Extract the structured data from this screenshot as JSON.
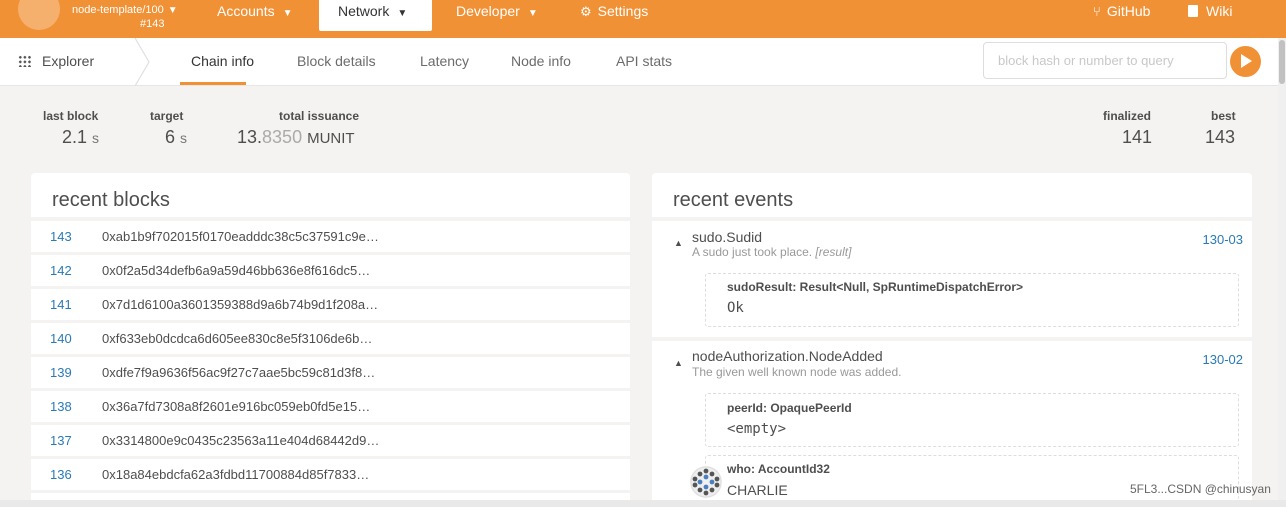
{
  "topbar": {
    "chain_name": "node-template/100",
    "chain_number": "#143",
    "accounts": "Accounts",
    "network": "Network",
    "developer": "Developer",
    "settings": "Settings",
    "github": "GitHub",
    "wiki": "Wiki"
  },
  "subbar": {
    "explorer": "Explorer",
    "tabs": [
      "Chain info",
      "Block details",
      "Latency",
      "Node info",
      "API stats"
    ],
    "search_placeholder": "block hash or number to query"
  },
  "summary": {
    "last_block_label": "last block",
    "last_block_value": "2.1",
    "last_block_unit": "s",
    "target_label": "target",
    "target_value": "6",
    "target_unit": "s",
    "total_issuance_label": "total issuance",
    "total_issuance_int": "13.",
    "total_issuance_frac": "8350",
    "total_issuance_unit": "MUNIT",
    "finalized_label": "finalized",
    "finalized_value": "141",
    "best_label": "best",
    "best_value": "143"
  },
  "recent_blocks": {
    "title": "recent blocks",
    "rows": [
      {
        "number": "143",
        "hash": "0xab1b9f702015f0170eadddc38c5c37591c9e…"
      },
      {
        "number": "142",
        "hash": "0x0f2a5d34defb6a9a59d46bb636e8f616dc5…"
      },
      {
        "number": "141",
        "hash": "0x7d1d6100a3601359388d9a6b74b9d1f208a…"
      },
      {
        "number": "140",
        "hash": "0xf633eb0dcdca6d605ee830c8e5f3106de6b…"
      },
      {
        "number": "139",
        "hash": "0xdfe7f9a9636f56ac9f27c7aae5bc59c81d3f8…"
      },
      {
        "number": "138",
        "hash": "0x36a7fd7308a8f2601e916bc059eb0fd5e15…"
      },
      {
        "number": "137",
        "hash": "0x3314800e9c0435c23563a11e404d68442d9…"
      },
      {
        "number": "136",
        "hash": "0x18a84ebdcfa62a3fdbd11700884d85f7833…"
      }
    ]
  },
  "recent_events": {
    "title": "recent events",
    "events": [
      {
        "name": "sudo.Sudid",
        "desc": "A sudo just took place.",
        "desc_tag": "[result]",
        "id": "130-03",
        "param_label": "sudoResult: Result<Null, SpRuntimeDispatchError>",
        "param_value": "Ok"
      },
      {
        "name": "nodeAuthorization.NodeAdded",
        "desc": "The given well known node was added.",
        "id": "130-02",
        "param1_label": "peerId: OpaquePeerId",
        "param1_value": "<empty>",
        "param2_label": "who: AccountId32",
        "param2_value": "CHARLIE"
      }
    ]
  },
  "watermark": "5FL3...CSDN @chinusyan",
  "colors": {
    "accent": "#f19135",
    "link": "#2a7bb4"
  }
}
